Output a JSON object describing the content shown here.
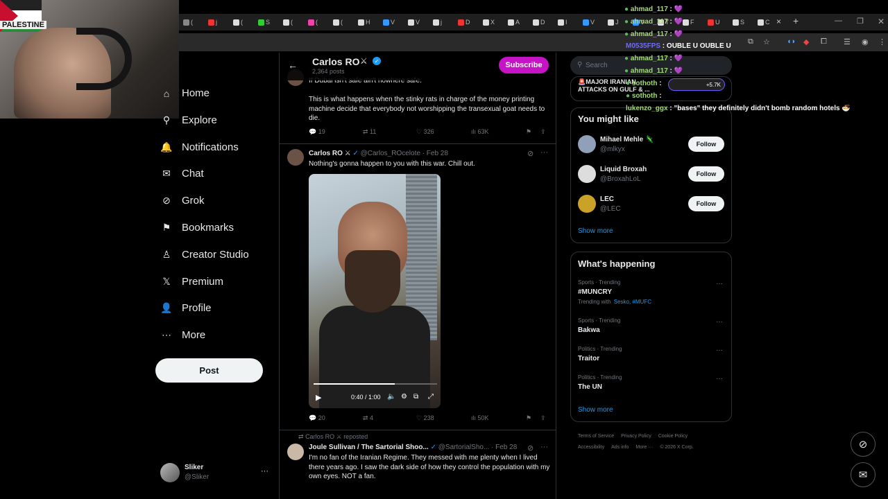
{
  "browser": {
    "tabs": [
      "(",
      "j",
      "(",
      "S",
      "(",
      "(",
      "(",
      "H",
      "V",
      "V",
      "j",
      "D",
      "X",
      "A",
      "D",
      "I",
      "V",
      "J",
      "V",
      "T",
      "F",
      "U",
      "S",
      "C"
    ],
    "active_tab_close": "×",
    "new_tab": "+"
  },
  "webcam": {
    "flag_text": "PALESTINE"
  },
  "stream_chat": [
    {
      "user": "ahmad_117",
      "msg": "💜",
      "color": "#a3d977"
    },
    {
      "user": "ahmad_117",
      "msg": "💜",
      "color": "#a3d977"
    },
    {
      "user": "ahmad_117",
      "msg": "💜",
      "color": "#a3d977"
    },
    {
      "user": "M0535FPS",
      "msg": "OUBLE U OUBLE U",
      "color": "#6b6bff"
    },
    {
      "user": "ahmad_117",
      "msg": "💜",
      "color": "#a3d977"
    },
    {
      "user": "ahmad_117",
      "msg": "💜",
      "color": "#a3d977"
    },
    {
      "user": "sothoth",
      "msg": "",
      "color": "#a3d977"
    },
    {
      "user": "sothoth",
      "msg": "",
      "color": "#a3d977"
    },
    {
      "user": "lukenzo_ggx",
      "msg": "\"bases\" they definitely didn't bomb random hotels 🍜",
      "color": "#a3d977"
    }
  ],
  "nav": {
    "items": [
      {
        "label": "Home",
        "icon": "home-icon",
        "glyph": "⌂"
      },
      {
        "label": "Explore",
        "icon": "search-icon",
        "glyph": "⚲"
      },
      {
        "label": "Notifications",
        "icon": "bell-icon",
        "glyph": "🔔"
      },
      {
        "label": "Chat",
        "icon": "mail-icon",
        "glyph": "✉"
      },
      {
        "label": "Grok",
        "icon": "grok-icon",
        "glyph": "⊘"
      },
      {
        "label": "Bookmarks",
        "icon": "bookmark-icon",
        "glyph": "⚑"
      },
      {
        "label": "Creator Studio",
        "icon": "creator-studio-icon",
        "glyph": "♙"
      },
      {
        "label": "Premium",
        "icon": "x-logo-icon",
        "glyph": "𝕏"
      },
      {
        "label": "Profile",
        "icon": "person-icon",
        "glyph": "👤"
      },
      {
        "label": "More",
        "icon": "more-circle-icon",
        "glyph": "⋯"
      }
    ],
    "post_label": "Post"
  },
  "account": {
    "name": "Sliker",
    "handle": "@Sliker",
    "more": "···"
  },
  "profile_header": {
    "name": "Carlos RO",
    "posts": "2,364 posts",
    "subscribe": "Subscribe"
  },
  "tweets": [
    {
      "text1": "If Dubai isn't safe ain't nowhere safe.",
      "text2": "This is what happens when the stinky rats in charge of the money printing machine decide that everybody not worshipping the transexual goat needs to die.",
      "replies": "19",
      "reposts": "11",
      "likes": "326",
      "views": "63K"
    },
    {
      "name": "Carlos RO",
      "handle": "@Carlos_ROcelote",
      "date": "· Feb 28",
      "text": "Nothing's gonna happen to you with this war. Chill out.",
      "video_time": "0:40 / 1:00",
      "replies": "20",
      "reposts": "4",
      "likes": "238",
      "views": "50K"
    },
    {
      "repost_label": "Carlos RO",
      "repost_suffix": "reposted",
      "name": "Joule Sullivan / The Sartorial Shoo...",
      "handle": "@SartorialSho...",
      "date": "· Feb 28",
      "text": "I'm no fan of the Iranian Regime. They messed with me plenty when I lived there years ago. I saw the dark side of how they control the population with my own eyes. NOT a fan."
    }
  ],
  "right": {
    "search_placeholder": "Search",
    "live_headline": "🚨MAJOR IRANIAN ATTACKS ON GULF & ...",
    "live_count": "+5.7K",
    "you_might_like": "You might like",
    "suggestions": [
      {
        "name": "Mihael Mehle 🦎",
        "handle": "@mlkyx",
        "follow": "Follow",
        "color": "#8fa0b8"
      },
      {
        "name": "Liquid Broxah",
        "handle": "@BroxahLoL",
        "follow": "Follow",
        "color": "#dddddd"
      },
      {
        "name": "LEC",
        "handle": "@LEC",
        "follow": "Follow",
        "color": "#c9a227"
      }
    ],
    "show_more": "Show more",
    "whats_happening": "What's happening",
    "trends": [
      {
        "cat": "Sports · Trending",
        "name": "#MUNCRY",
        "extra_prefix": "Trending with",
        "extra_links": "Sesko, #MUFC"
      },
      {
        "cat": "Sports · Trending",
        "name": "Bakwa"
      },
      {
        "cat": "Politics · Trending",
        "name": "Traitor"
      },
      {
        "cat": "Politics · Trending",
        "name": "The UN"
      }
    ],
    "footer": [
      "Terms of Service",
      "Privacy Policy",
      "Cookie Policy",
      "Accessibility",
      "Ads info",
      "More ···",
      "© 2026 X Corp."
    ]
  },
  "colors": {
    "verified": "#1d9bf0",
    "subscribe": "#c613c6",
    "accent": "#1d9bf0"
  }
}
